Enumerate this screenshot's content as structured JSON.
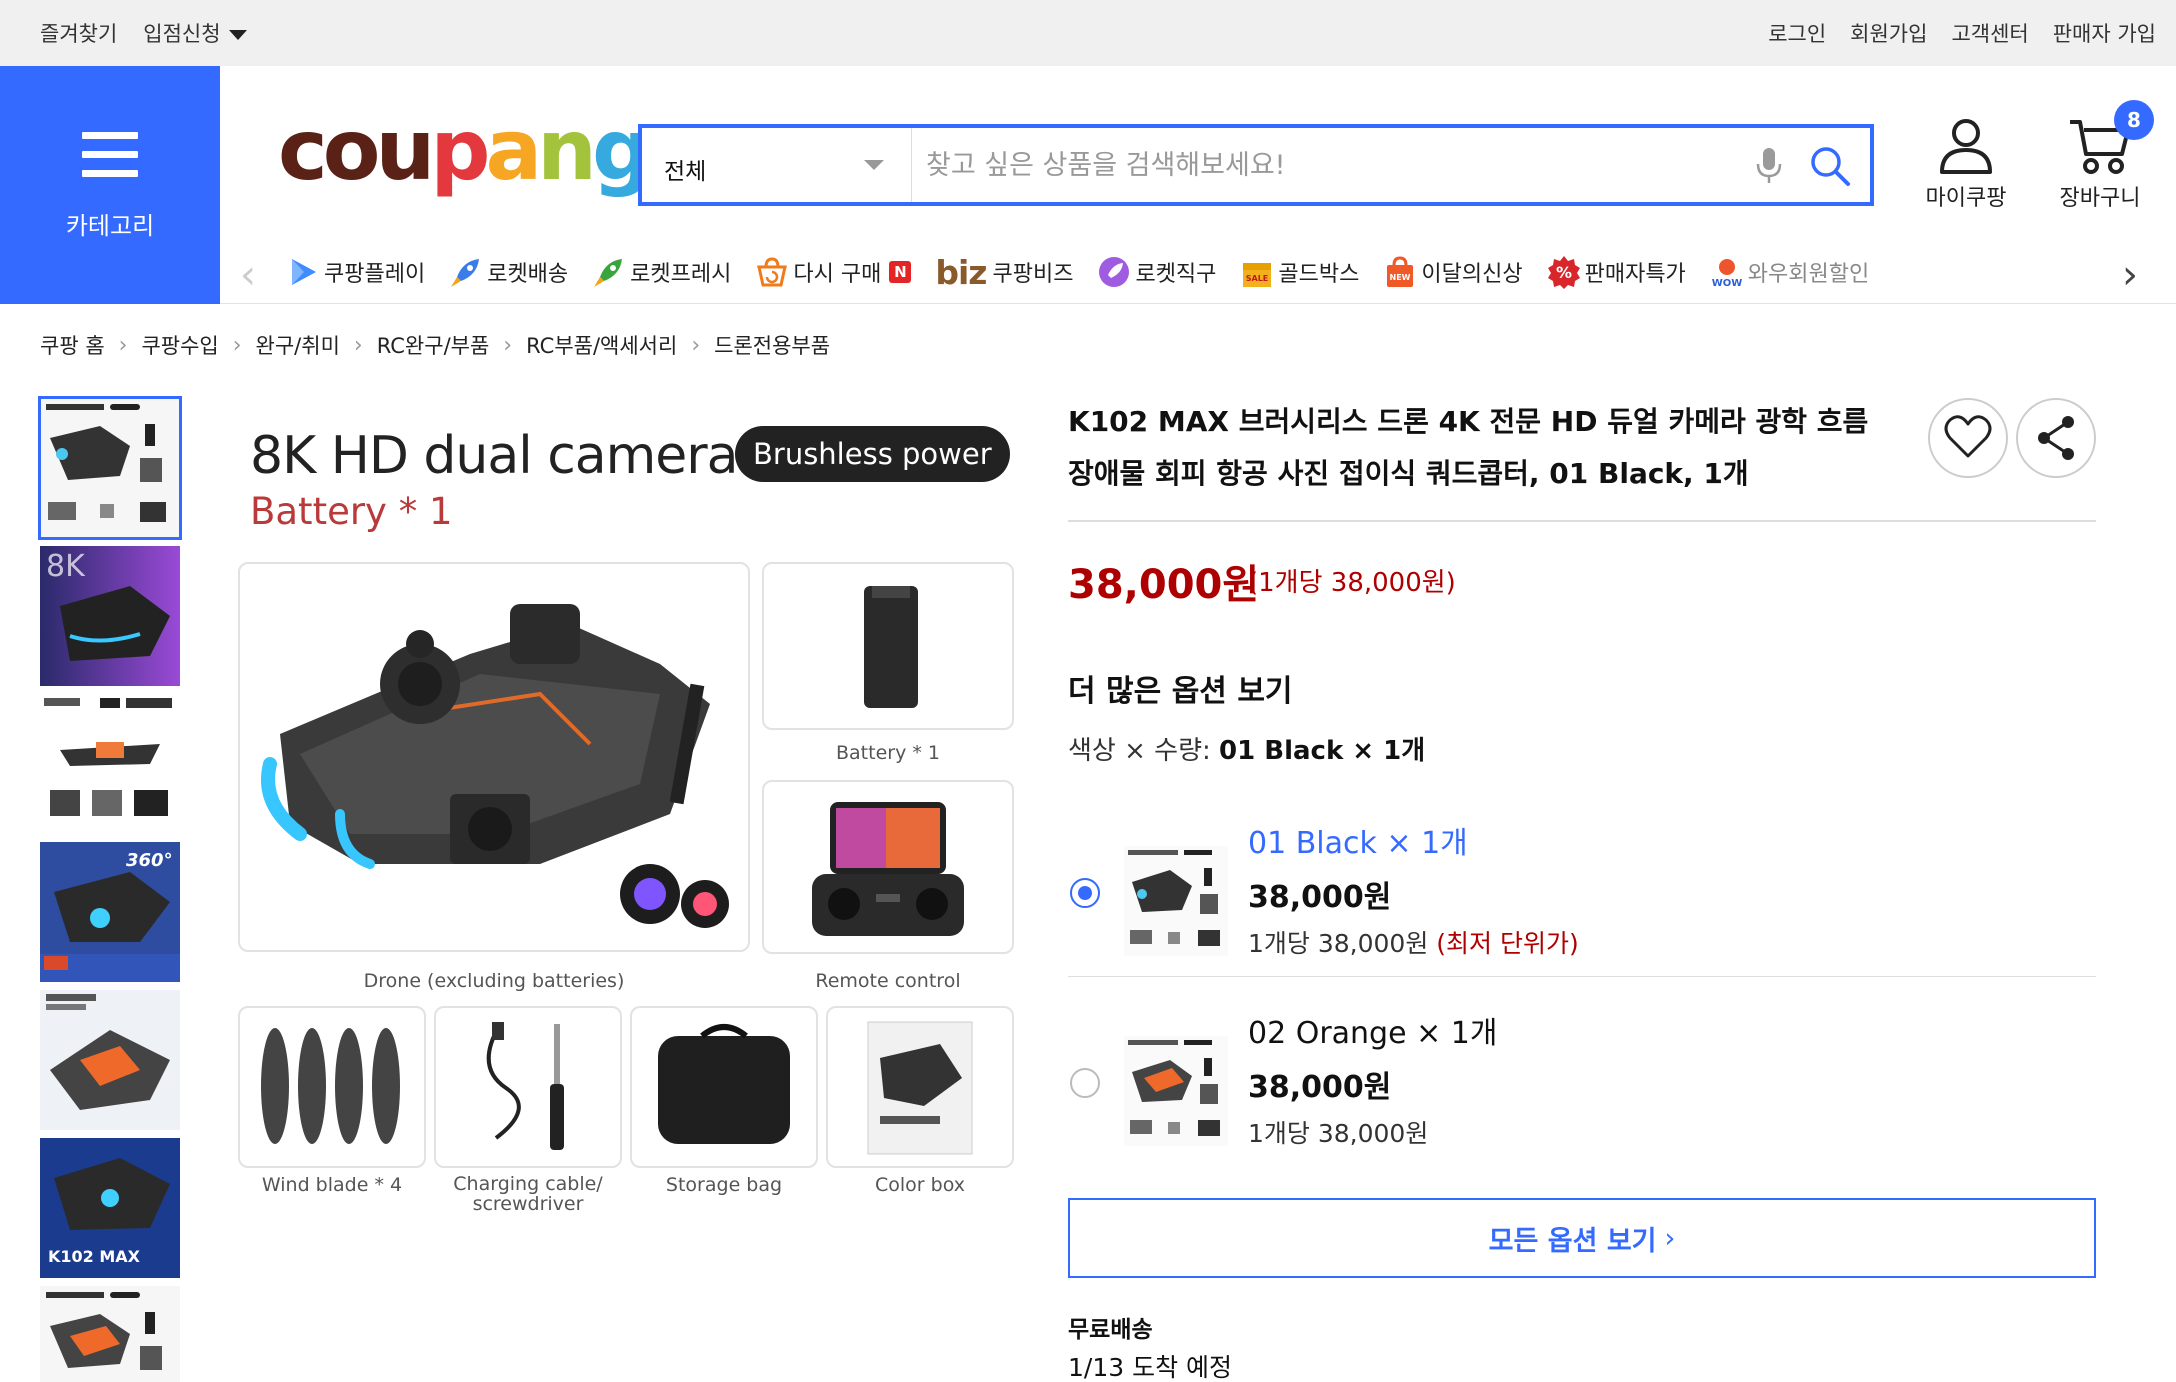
{
  "topbar": {
    "bookmark": "즐겨찾기",
    "seller_apply": "입점신청",
    "login": "로그인",
    "signup": "회원가입",
    "customer_center": "고객센터",
    "seller_join": "판매자 가입"
  },
  "header": {
    "category_label": "카테고리",
    "logo_parts": [
      "cou",
      "p",
      "a",
      "n",
      "g"
    ],
    "search_scope": "전체",
    "search_placeholder": "찾고 싶은 상품을 검색해보세요!",
    "my_coupang": "마이쿠팡",
    "cart": "장바구니",
    "cart_count": "8"
  },
  "category_bar": {
    "items": [
      {
        "label": "쿠팡플레이",
        "icon": "play-icon"
      },
      {
        "label": "로켓배송",
        "icon": "rocket-icon"
      },
      {
        "label": "로켓프레시",
        "icon": "rocket-fresh-icon"
      },
      {
        "label": "다시 구매",
        "icon": "reorder-icon",
        "badge": "N"
      },
      {
        "label": "쿠팡비즈",
        "prefix": "biz"
      },
      {
        "label": "로켓직구",
        "icon": "rocket-global-icon"
      },
      {
        "label": "골드박스",
        "icon": "goldbox-icon"
      },
      {
        "label": "이달의신상",
        "icon": "new-bag-icon"
      },
      {
        "label": "판매자특가",
        "icon": "percent-icon"
      },
      {
        "label": "와우회원할인",
        "icon": "wow-icon"
      }
    ]
  },
  "breadcrumb": [
    "쿠팡 홈",
    "쿠팡수입",
    "완구/취미",
    "RC완구/부품",
    "RC부품/액세서리",
    "드론전용부품"
  ],
  "main_image": {
    "title": "8K HD dual camera",
    "pill": "Brushless power",
    "subtitle": "Battery * 1",
    "captions": {
      "drone": "Drone (excluding batteries)",
      "battery": "Battery * 1",
      "remote": "Remote control",
      "blade": "Wind blade * 4",
      "cable": "Charging cable/ screwdriver",
      "bag": "Storage bag",
      "box": "Color box"
    }
  },
  "product": {
    "title": "K102 MAX 브러시리스 드론 4K 전문 HD 듀얼 카메라 광학 흐름 장애물 회피 항공 사진 접이식 쿼드콥터, 01 Black, 1개",
    "price": "38,000원",
    "unit_price": "(1개당 38,000원)",
    "more_options": "더 많은 옵션 보기",
    "combo_label": "색상 × 수량:",
    "combo_value": "01 Black × 1개",
    "options": [
      {
        "name": "01 Black × 1개",
        "price": "38,000원",
        "unit": "1개당 38,000원",
        "lowest": "(최저 단위가)",
        "selected": true
      },
      {
        "name": "02 Orange × 1개",
        "price": "38,000원",
        "unit": "1개당 38,000원",
        "lowest": "",
        "selected": false
      }
    ],
    "all_options": "모든 옵션 보기",
    "free_shipping": "무료배송",
    "arrival": "1/13 도착 예정"
  },
  "colors": {
    "brand_blue": "#346aff",
    "price_red": "#ae0000",
    "topbar_bg": "#f0f0f0"
  }
}
